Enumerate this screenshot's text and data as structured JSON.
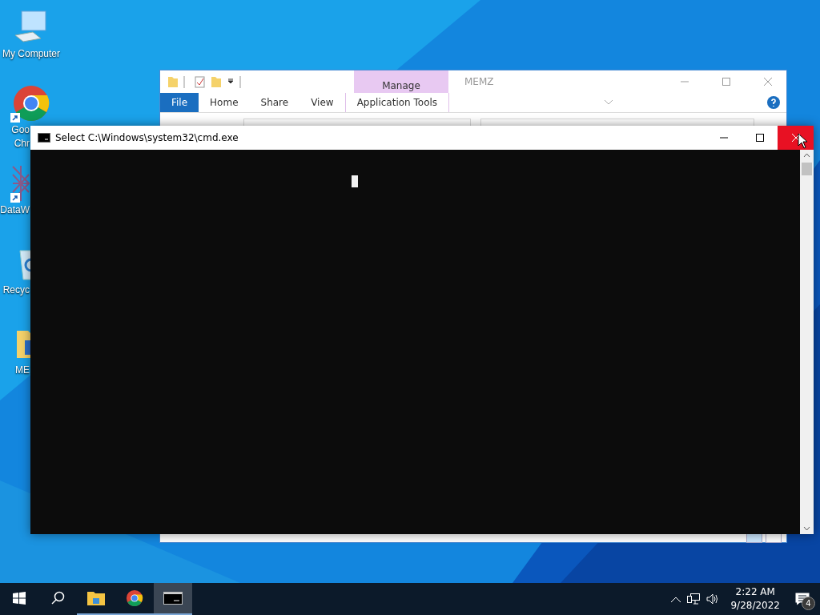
{
  "desktop_icons": [
    {
      "kind": "computer",
      "shortcut": false,
      "label_lines": [
        "My Computer"
      ]
    },
    {
      "kind": "chrome",
      "shortcut": true,
      "label_lines": [
        "Goo",
        "Chr"
      ]
    },
    {
      "kind": "mesh",
      "shortcut": true,
      "label_lines": [
        "DataW"
      ]
    },
    {
      "kind": "recycle",
      "shortcut": false,
      "label_lines": [
        "Recyc"
      ]
    },
    {
      "kind": "folder",
      "shortcut": false,
      "label_lines": [
        "ME"
      ]
    }
  ],
  "explorer": {
    "title": "MEMZ",
    "contextual_tab": "Manage",
    "tabs": [
      {
        "label": "File",
        "kind": "file"
      },
      {
        "label": "Home",
        "kind": "tab"
      },
      {
        "label": "Share",
        "kind": "tab"
      },
      {
        "label": "View",
        "kind": "tab"
      },
      {
        "label": "Application Tools",
        "kind": "contextual"
      }
    ]
  },
  "console": {
    "title": "Select C:\\Windows\\system32\\cmd.exe",
    "cursor_visible": true,
    "close_hovered": true
  },
  "taskbar": {
    "buttons": [
      {
        "kind": "start",
        "running": false,
        "selected": false
      },
      {
        "kind": "search",
        "running": false,
        "selected": false
      },
      {
        "kind": "explorer",
        "running": true,
        "selected": false
      },
      {
        "kind": "chrome",
        "running": true,
        "selected": false
      },
      {
        "kind": "cmd",
        "running": true,
        "selected": true
      }
    ],
    "time": "2:22 AM",
    "date": "9/28/2022",
    "notifications": "4"
  }
}
